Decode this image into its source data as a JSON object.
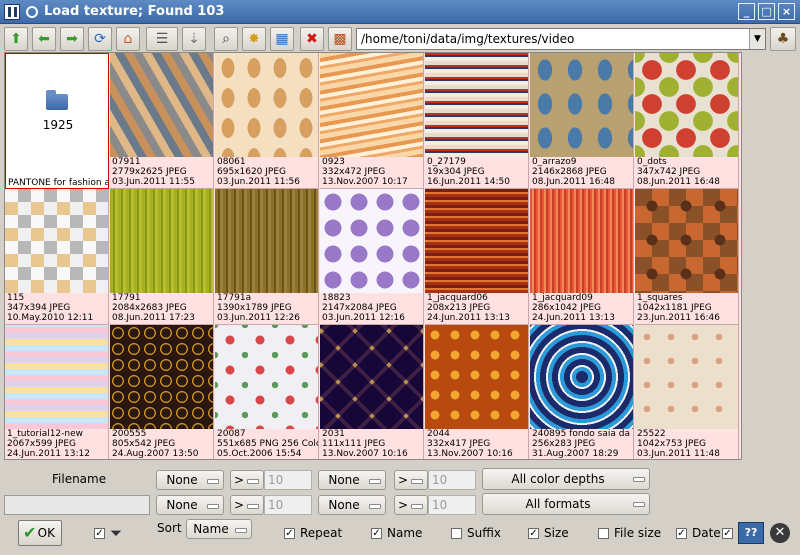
{
  "window": {
    "title": "Load texture; Found 103"
  },
  "toolbar": {
    "path": "/home/toni/data/img/textures/video"
  },
  "folder": {
    "label": "1925",
    "caption": "PANTONE for fashion and"
  },
  "thumbnails": [
    {
      "name": "07911",
      "info": "2779x2625 JPEG",
      "date": "03.Jun.2011 11:55"
    },
    {
      "name": "08061",
      "info": "695x1620 JPEG",
      "date": "03.Jun.2011 11:56"
    },
    {
      "name": "0923",
      "info": "332x472 JPEG",
      "date": "13.Nov.2007 10:17"
    },
    {
      "name": "0_27179",
      "info": "19x304 JPEG",
      "date": "16.Jun.2011 14:50"
    },
    {
      "name": "0_arrazo9",
      "info": "2146x2868 JPEG",
      "date": "08.Jun.2011 16:48"
    },
    {
      "name": "0_dots",
      "info": "347x742 JPEG",
      "date": "08.Jun.2011 16:48"
    },
    {
      "name": "115",
      "info": "347x394 JPEG",
      "date": "10.May.2010 12:11"
    },
    {
      "name": "17791",
      "info": "2084x2683 JPEG",
      "date": "08.Jun.2011 17:23"
    },
    {
      "name": "17791a",
      "info": "1390x1789 JPEG",
      "date": "03.Jun.2011 12:26"
    },
    {
      "name": "18823",
      "info": "2147x2084 JPEG",
      "date": "03.Jun.2011 12:16"
    },
    {
      "name": "1_jacquard06",
      "info": "208x213 JPEG",
      "date": "24.Jun.2011 13:13"
    },
    {
      "name": "1_jacquard09",
      "info": "286x1042 JPEG",
      "date": "24.Jun.2011 13:13"
    },
    {
      "name": "1_squares",
      "info": "1042x1181 JPEG",
      "date": "23.Jun.2011 16:46"
    },
    {
      "name": "1_tutorial12-new",
      "info": "2067x599 JPEG",
      "date": "24.Jun.2011 13:12"
    },
    {
      "name": "200555",
      "info": "805x542 JPEG",
      "date": "24.Aug.2007 13:50"
    },
    {
      "name": "20087",
      "info": "551x685 PNG 256 Colors",
      "date": "05.Oct.2006 15:54"
    },
    {
      "name": "2031",
      "info": "111x111 JPEG",
      "date": "13.Nov.2007 10:16"
    },
    {
      "name": "2044",
      "info": "332x417 JPEG",
      "date": "13.Nov.2007 10:16"
    },
    {
      "name": "240895 fondo saia da 4",
      "info": "256x283 JPEG",
      "date": "31.Aug.2007 18:29"
    },
    {
      "name": "25522",
      "info": "1042x753 JPEG",
      "date": "03.Jun.2011 11:48"
    }
  ],
  "filters": {
    "filename_label": "Filename",
    "row1": {
      "sel1": "None",
      "op1": ">",
      "num1": "10",
      "sel2": "None",
      "op2": ">",
      "num2": "10",
      "depth": "All color depths"
    },
    "row2": {
      "sel1": "None",
      "op1": ">",
      "num1": "10",
      "sel2": "None",
      "op2": ">",
      "num2": "10",
      "formats": "All formats"
    }
  },
  "bottom": {
    "ok_label": "OK",
    "sort_label": "Sort",
    "sort_value": "Name",
    "checks": [
      {
        "label": "Repeat",
        "checked": true
      },
      {
        "label": "Name",
        "checked": true
      },
      {
        "label": "Suffix",
        "checked": false
      },
      {
        "label": "Size",
        "checked": true
      },
      {
        "label": "File size",
        "checked": false
      },
      {
        "label": "Date",
        "checked": true
      }
    ],
    "help_label": "??"
  }
}
